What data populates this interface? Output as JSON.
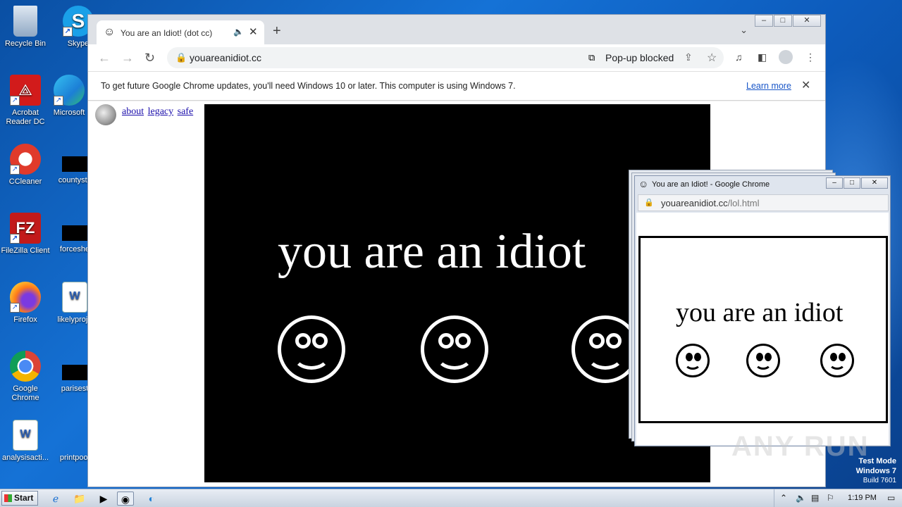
{
  "desktop": {
    "icons": [
      {
        "label": "Recycle Bin"
      },
      {
        "label": "Skype"
      },
      {
        "label": "Acrobat Reader DC"
      },
      {
        "label": "Microsoft"
      },
      {
        "label": "CCleaner"
      },
      {
        "label": "countystc"
      },
      {
        "label": "FileZilla Client"
      },
      {
        "label": "forceshe"
      },
      {
        "label": "Firefox"
      },
      {
        "label": "likelyproje"
      },
      {
        "label": "Google Chrome"
      },
      {
        "label": "parisest"
      },
      {
        "label": "analysisacti..."
      },
      {
        "label": "printpool"
      }
    ]
  },
  "chrome": {
    "tab_title": "You are an Idiot! (dot cc)",
    "url": "youareanidiot.cc",
    "popup_blocked": "Pop-up blocked",
    "infobar_message": "To get future Google Chrome updates, you'll need Windows 10 or later. This computer is using Windows 7.",
    "learn_more": "Learn more",
    "links": [
      "about",
      "legacy",
      "safe"
    ],
    "headline": "you are an idiot"
  },
  "popup": {
    "title": "You are an Idiot! - Google Chrome",
    "url_host": "youareanidiot.cc",
    "url_path": "/lol.html",
    "headline": "you are an idiot"
  },
  "taskbar": {
    "start_label": "Start",
    "clock": "1:19 PM"
  },
  "watermark": {
    "line1": "Test Mode",
    "line2": "Windows 7",
    "line3": "Build 7601",
    "brand": "ANY RUN"
  }
}
